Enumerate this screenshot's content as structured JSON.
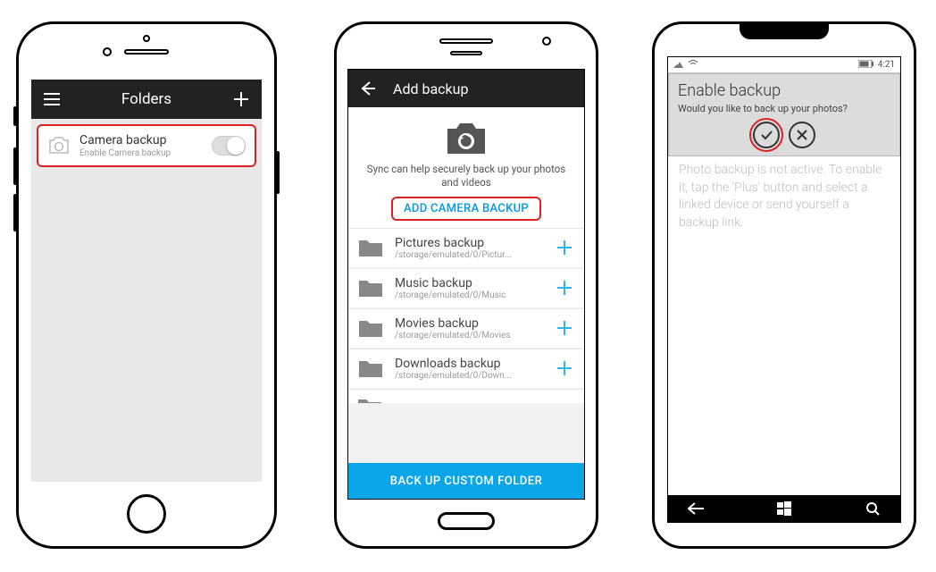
{
  "ios": {
    "title": "Folders",
    "row": {
      "title": "Camera backup",
      "subtitle": "Enable Camera backup"
    }
  },
  "android": {
    "title": "Add backup",
    "hero_desc": "Sync can help securely back up your photos and videos",
    "add_camera": "ADD CAMERA BACKUP",
    "items": [
      {
        "name": "Pictures backup",
        "path": "/storage/emulated/0/Pictur..."
      },
      {
        "name": "Music backup",
        "path": "/storage/emulated/0/Music"
      },
      {
        "name": "Movies backup",
        "path": "/storage/emulated/0/Movies"
      },
      {
        "name": "Downloads backup",
        "path": "/storage/emulated/0/Down..."
      }
    ],
    "footer": "BACK UP CUSTOM FOLDER"
  },
  "win": {
    "time": "4:21",
    "card_title": "Enable backup",
    "card_question": "Would you like to back up your photos?",
    "body": "Photo backup is not active. To enable it, tap the 'Plus' button and select a linked device or send yourself a backup link."
  }
}
